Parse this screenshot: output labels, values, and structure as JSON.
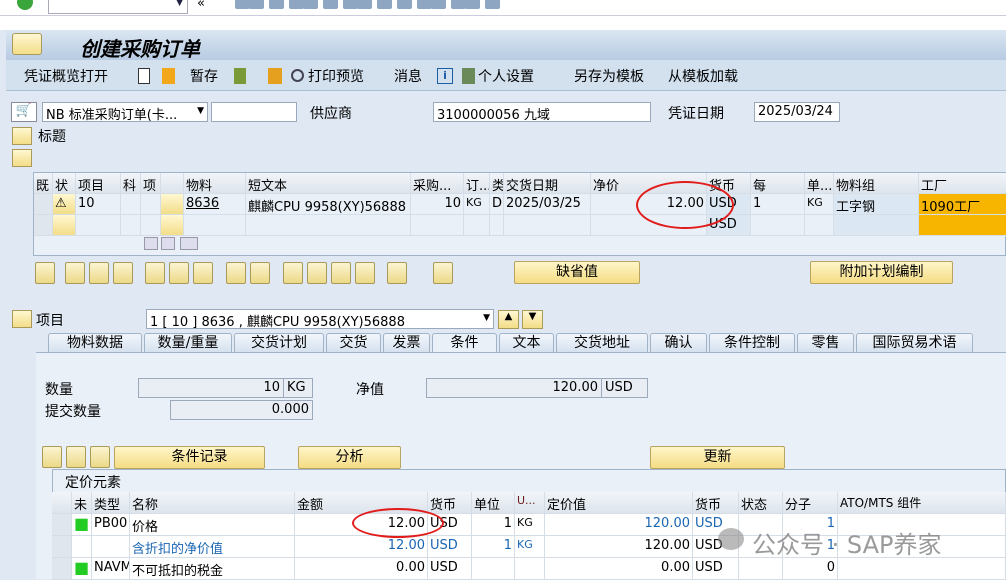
{
  "window": {
    "title": "创建采购订单"
  },
  "system_toolbar": {
    "command_field": "",
    "icons": [
      "check-icon",
      "save-icon",
      "back-icon",
      "exit-icon",
      "cancel-icon",
      "print-icon",
      "find-icon",
      "find-next-icon",
      "first-page-icon",
      "prev-page-icon",
      "next-page-icon",
      "last-page-icon",
      "new-session-icon",
      "shortcut-icon",
      "help-icon",
      "customize-icon"
    ]
  },
  "app_toolbar": {
    "items": [
      "凭证概览打开",
      "暂存",
      "打印预览",
      "消息",
      "个人设置",
      "另存为模板",
      "从模板加载"
    ]
  },
  "header": {
    "doc_type": "NB 标准采购订单(卡...",
    "doc_number": "",
    "vendor_label": "供应商",
    "vendor": "3100000056 九域",
    "date_label": "凭证日期",
    "date": "2025/03/24",
    "title_label": "标题"
  },
  "items_grid": {
    "columns": [
      "既",
      "状",
      "项目",
      "科",
      "项",
      "",
      "物料",
      "短文本",
      "采购...",
      "订...",
      "类",
      "交货日期",
      "净价",
      "货币",
      "每",
      "单...",
      "物料组",
      "工厂"
    ],
    "rows": [
      [
        "",
        "⚠",
        "10",
        "",
        "",
        "",
        "8636",
        "麒麟CPU 9958(XY)56888",
        "10",
        "KG",
        "D",
        "2025/03/25",
        "12.00",
        "USD",
        "1",
        "KG",
        "工字钢",
        "1090工厂"
      ],
      [
        "",
        "",
        "",
        "",
        "",
        "",
        "",
        "",
        "",
        "",
        "",
        "",
        "",
        "USD",
        "",
        "",
        "",
        ""
      ]
    ]
  },
  "grid_buttons": {
    "defaults": "缺省值",
    "additional_planning": "附加计划编制"
  },
  "item_detail": {
    "label": "项目",
    "selected": "1 [ 10 ] 8636 , 麒麟CPU 9958(XY)56888"
  },
  "tabs": [
    "物料数据",
    "数量/重量",
    "交货计划",
    "交货",
    "发票",
    "条件",
    "文本",
    "交货地址",
    "确认",
    "条件控制",
    "零售",
    "国际贸易术语"
  ],
  "active_tab": "条件",
  "conditions": {
    "qty_label": "数量",
    "qty": "10",
    "qty_unit": "KG",
    "net_label": "净值",
    "net": "120.00",
    "net_curr": "USD",
    "submitted_label": "提交数量",
    "submitted": "0.000",
    "btn_records": "条件记录",
    "btn_analysis": "分析",
    "btn_update": "更新"
  },
  "pricing": {
    "title": "定价元素",
    "columns": [
      "未",
      "类型",
      "名称",
      "金额",
      "货币",
      "单位",
      "U...",
      "定价值",
      "货币",
      "状态",
      "分子",
      "ATO/MTS 组件"
    ],
    "rows": [
      [
        "■",
        "PB00",
        "价格",
        "12.00",
        "USD",
        "1",
        "KG",
        "120.00",
        "USD",
        "",
        "1",
        ""
      ],
      [
        "",
        "",
        "含折扣的净价值",
        "12.00",
        "USD",
        "1",
        "KG",
        "120.00",
        "USD",
        "",
        "1",
        ""
      ],
      [
        "■",
        "NAVM",
        "不可抵扣的税金",
        "0.00",
        "USD",
        "",
        "",
        "0.00",
        "USD",
        "",
        "0",
        ""
      ]
    ]
  },
  "watermark": "公众号 · SAP养家",
  "colors": {
    "highlight": "#e21b1b",
    "plant_cell": "#f7b500",
    "status_green": "#22cc22",
    "link_blue": "#1a66b3"
  }
}
